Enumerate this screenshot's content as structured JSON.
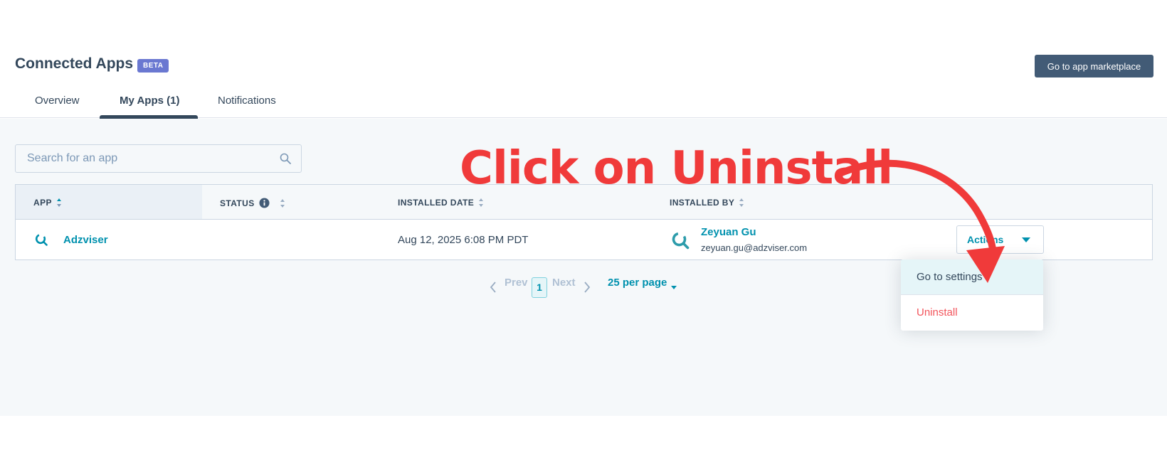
{
  "header": {
    "title": "Connected Apps",
    "badge": "BETA",
    "marketplace_button": "Go to app marketplace"
  },
  "tabs": [
    {
      "label": "Overview",
      "active": false
    },
    {
      "label": "My Apps (1)",
      "active": true
    },
    {
      "label": "Notifications",
      "active": false
    }
  ],
  "search": {
    "placeholder": "Search for an app",
    "value": ""
  },
  "table": {
    "columns": [
      "APP",
      "STATUS",
      "INSTALLED DATE",
      "INSTALLED BY"
    ],
    "rows": [
      {
        "app": "Adzviser",
        "status": "",
        "installed_date": "Aug 12, 2025 6:08 PM PDT",
        "installed_by_name": "Zeyuan Gu",
        "installed_by_email": "zeyuan.gu@adzviser.com",
        "actions_label": "Actions"
      }
    ]
  },
  "pagination": {
    "prev": "Prev",
    "current": "1",
    "next": "Next",
    "per_page": "25 per page"
  },
  "actions_menu": {
    "items": [
      "Go to settings",
      "Uninstall"
    ]
  },
  "annotation": {
    "text": "Click on Uninstall"
  },
  "colors": {
    "accent": "#0091ae",
    "primary_dark": "#425b76",
    "badge": "#6a78d1",
    "danger": "#f2545b",
    "annotation": "#f03a3a"
  },
  "icons": {
    "search": "search-icon",
    "sort": "sort-icon",
    "info": "info-icon",
    "app_logo": "adzviser-logo-icon",
    "caret": "caret-down-icon"
  }
}
